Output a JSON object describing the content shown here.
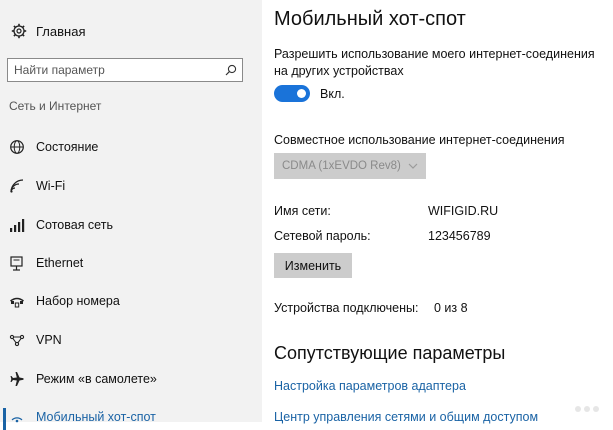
{
  "sidebar": {
    "home_label": "Главная",
    "search_placeholder": "Найти параметр",
    "section_title": "Сеть и Интернет",
    "items": [
      {
        "label": "Состояние",
        "icon": "globe-icon"
      },
      {
        "label": "Wi-Fi",
        "icon": "wifi-icon"
      },
      {
        "label": "Сотовая сеть",
        "icon": "cellular-icon"
      },
      {
        "label": "Ethernet",
        "icon": "ethernet-icon"
      },
      {
        "label": "Набор номера",
        "icon": "dialup-icon"
      },
      {
        "label": "VPN",
        "icon": "vpn-icon"
      },
      {
        "label": "Режим «в самолете»",
        "icon": "airplane-icon"
      },
      {
        "label": "Мобильный хот-спот",
        "icon": "hotspot-icon",
        "active": true
      }
    ]
  },
  "main": {
    "title": "Мобильный хот-спот",
    "share_description": "Разрешить использование моего интернет-соединения на других устройствах",
    "toggle_label": "Вкл.",
    "toggle_on": true,
    "connection_share_label": "Совместное использование интернет-соединения",
    "connection_selected": "CDMA (1xEVDO Rev8)",
    "network_name_label": "Имя сети:",
    "network_name_value": "WIFIGID.RU",
    "password_label": "Сетевой пароль:",
    "password_value": "123456789",
    "edit_button": "Изменить",
    "devices_label": "Устройства подключены:",
    "devices_value": "0 из 8",
    "related_title": "Сопутствующие параметры",
    "links": [
      "Настройка параметров адаптера",
      "Центр управления сетями и общим доступом"
    ]
  },
  "colors": {
    "accent": "#1a73d9",
    "link": "#1a63a5",
    "sidebar_bg": "#f2f2f2",
    "disabled_bg": "#cccccc"
  }
}
